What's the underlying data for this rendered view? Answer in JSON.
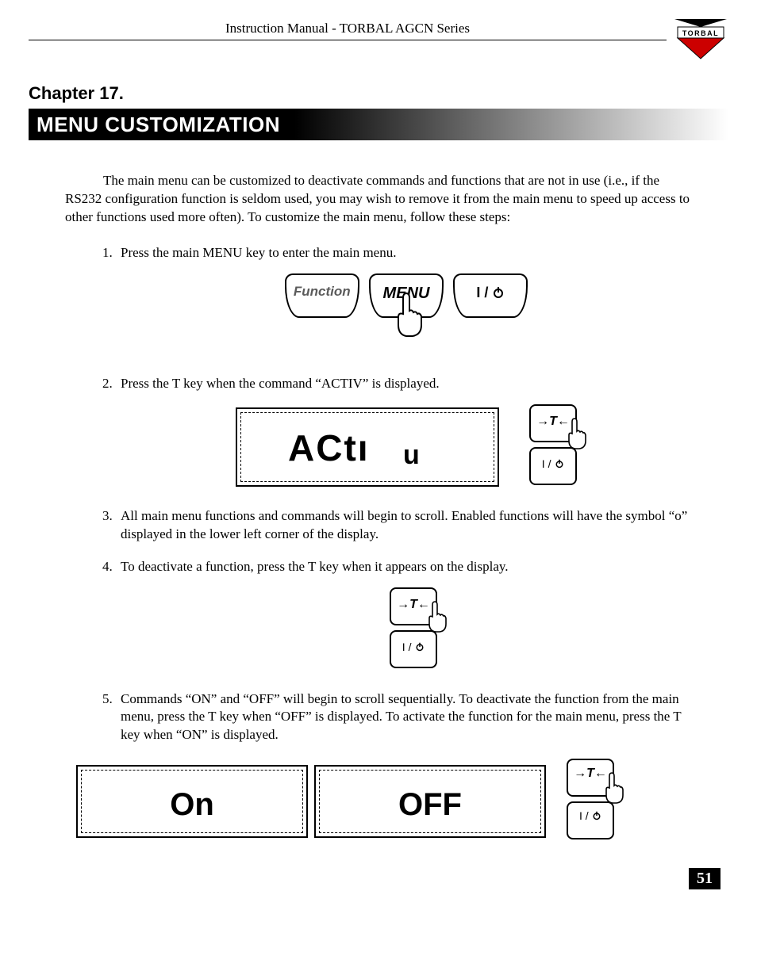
{
  "header": {
    "title": "Instruction Manual - TORBAL AGCN Series",
    "logo_text": "TORBAL"
  },
  "chapter": "Chapter 17.",
  "banner": "MENU CUSTOMIZATION",
  "intro": "The main menu can be customized to deactivate commands and functions that are not in use (i.e., if the RS232 configuration function is seldom used, you may wish to remove it from the main menu to speed up access to other functions used more often).   To customize the main menu, follow these steps:",
  "steps": {
    "s1": "Press the main MENU key to enter the main menu.",
    "s2": "Press the T key when the command “ACTIV” is displayed.",
    "s3": "All main menu functions and commands will begin to scroll.   Enabled functions will have the symbol “o” displayed in the lower left corner of the display.",
    "s4": "To deactivate a function, press the T key when it appears on the display.",
    "s5": "Commands “ON” and “OFF” will begin to scroll sequentially.  To deactivate the function from the main menu, press the T key when “OFF” is displayed.   To activate the function for the main menu, press the T key when “ON” is displayed."
  },
  "keys": {
    "function": "Function",
    "menu": "MENU",
    "power": "I /⏻",
    "t": "→T←"
  },
  "lcd": {
    "activ": "ACti v",
    "on": "On",
    "off": "OFF"
  },
  "page_number": "51"
}
